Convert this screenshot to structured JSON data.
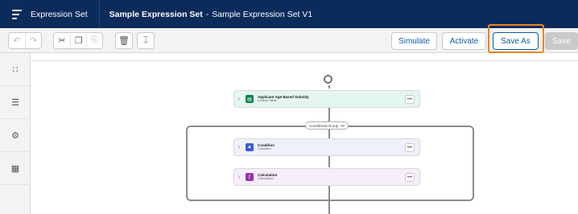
{
  "header": {
    "app_icon": "expression-set-icon",
    "app_name": "Expression Set",
    "title_main": "Sample Expression Set",
    "title_sep": "-",
    "title_version": "Sample Expression Set V1",
    "background": "#0b2b5b"
  },
  "toolbar": {
    "undo_icon": "undo-icon",
    "redo_icon": "redo-icon",
    "cut_icon": "cut-icon",
    "copy_icon": "copy-icon",
    "paste_icon": "paste-icon",
    "delete_icon": "delete-icon",
    "align_icon": "align-icon",
    "simulate_label": "Simulate",
    "activate_label": "Activate",
    "save_as_label": "Save As",
    "save_label": "Save",
    "highlight_color": "#e8861b"
  },
  "rail": {
    "items": [
      {
        "icon": "elements-icon"
      },
      {
        "icon": "list-icon"
      },
      {
        "icon": "settings-icon"
      },
      {
        "icon": "resources-icon"
      }
    ]
  },
  "canvas": {
    "group_label": "Conditional Group",
    "group_menu": "•••",
    "nodes": [
      {
        "title": "Applicant Age Based Subsidy",
        "subtitle": "Lookup Table",
        "icon": "table-icon",
        "bg": "#e3f6f0",
        "icon_bg": "#04844b"
      },
      {
        "title": "Condition",
        "subtitle": "Condition",
        "icon": "condition-icon",
        "bg": "#eef1fb",
        "icon_bg": "#3b5bdb"
      },
      {
        "title": "Calculation",
        "subtitle": "Calculation",
        "icon": "calculation-icon",
        "bg": "#f7eefb",
        "icon_bg": "#9b2fae"
      }
    ],
    "node_menu": "•••"
  }
}
